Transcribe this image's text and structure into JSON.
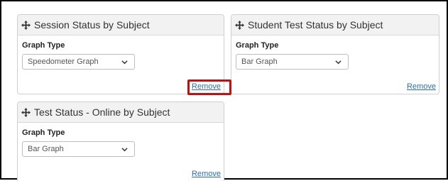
{
  "widgets": [
    {
      "title": "Session Status by Subject",
      "field_label": "Graph Type",
      "select_value": "Speedometer Graph",
      "remove_label": "Remove"
    },
    {
      "title": "Student Test Status by Subject",
      "field_label": "Graph Type",
      "select_value": "Bar Graph",
      "remove_label": "Remove"
    },
    {
      "title": "Test Status - Online by Subject",
      "field_label": "Graph Type",
      "select_value": "Bar Graph",
      "remove_label": "Remove"
    }
  ],
  "icons": {
    "move": "move-icon",
    "dropdown": "chevron-down-icon"
  },
  "colors": {
    "link": "#2a6fb8",
    "highlight": "#c01010",
    "header_bg": "#f2f2f2"
  }
}
